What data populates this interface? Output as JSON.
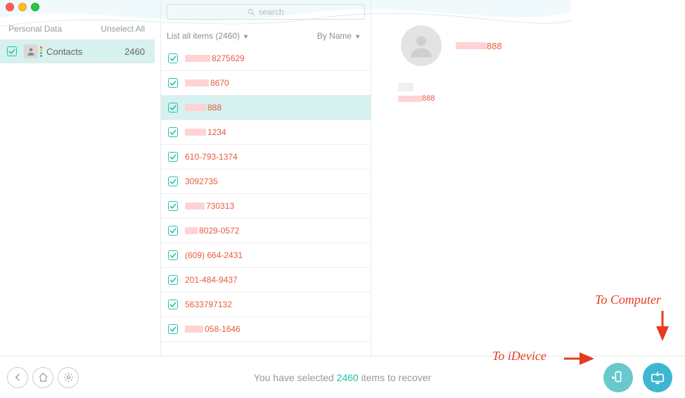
{
  "sidebar": {
    "header": "Personal Data",
    "unselect": "Unselect All",
    "item": {
      "label": "Contacts",
      "count": "2460"
    }
  },
  "search": {
    "placeholder": "search"
  },
  "list_header": {
    "left": "List all items (2460)",
    "right": "By Name"
  },
  "contacts": [
    {
      "redact_w": 36,
      "text": "8275629",
      "selected": false
    },
    {
      "redact_w": 34,
      "text": "8670",
      "selected": false
    },
    {
      "redact_w": 30,
      "text": "888",
      "selected": true
    },
    {
      "redact_w": 30,
      "text": "1234",
      "selected": false
    },
    {
      "redact_w": 0,
      "text": "610-793-1374",
      "selected": false
    },
    {
      "redact_w": 0,
      "text": "3092735",
      "selected": false
    },
    {
      "redact_w": 28,
      "text": "730313",
      "selected": false
    },
    {
      "redact_w": 18,
      "text": "8029-0572",
      "selected": false
    },
    {
      "redact_w": 0,
      "text": "(609) 664-2431",
      "selected": false
    },
    {
      "redact_w": 0,
      "text": "201-484-9437",
      "selected": false
    },
    {
      "redact_w": 0,
      "text": "5633797132",
      "selected": false
    },
    {
      "redact_w": 26,
      "text": "058-1646",
      "selected": false
    }
  ],
  "detail": {
    "name_suffix": "888",
    "phone_suffix": "888"
  },
  "status": {
    "prefix": "You have selected ",
    "count": "2460",
    "suffix": " items to recover"
  },
  "annotations": {
    "device": "To iDevice",
    "computer": "To Computer"
  }
}
